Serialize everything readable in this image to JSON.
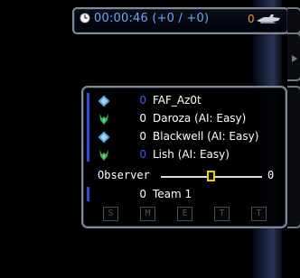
{
  "timer": {
    "text": "00:00:46 (+0 / +0)",
    "unit_count": "0"
  },
  "scoreboard": {
    "players": [
      {
        "score": "0",
        "name": "FAF_Az0t",
        "faction_icon": "uef-icon",
        "score_color": "#3b5bff"
      },
      {
        "score": "0",
        "name": "Daroza (AI: Easy)",
        "faction_icon": "seraphim-icon",
        "score_color": "#ffffff"
      },
      {
        "score": "0",
        "name": "Blackwell (AI: Easy)",
        "faction_icon": "uef-icon",
        "score_color": "#ffffff"
      },
      {
        "score": "0",
        "name": "Lish (AI: Easy)",
        "faction_icon": "seraphim-icon",
        "score_color": "#3b5bff"
      }
    ],
    "observer": {
      "label": "Observer",
      "value": "0"
    },
    "team": {
      "score": "0",
      "name": "Team 1"
    },
    "team_buttons": [
      "S",
      "M",
      "E",
      "T",
      "T"
    ]
  },
  "colors": {
    "timer_text": "#66a9ff",
    "unit_count": "#f0922a",
    "team_bar": "#2e49d6",
    "slider_thumb": "#e8d400"
  }
}
